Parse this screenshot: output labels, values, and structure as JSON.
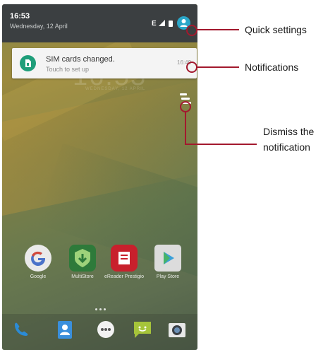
{
  "status_bar": {
    "time": "16:53",
    "date": "Wednesday, 12 April",
    "network_label": "E",
    "icons": [
      "signal-icon",
      "battery-icon",
      "user-icon"
    ]
  },
  "notification": {
    "title": "SIM cards changed.",
    "subtitle": "Touch to set up",
    "time": "16:49",
    "icon": "sim-card-icon",
    "icon_color": "#1f9e7a"
  },
  "home_screen": {
    "apps": [
      {
        "label": "Google",
        "icon": "google-icon"
      },
      {
        "label": "MultiStore",
        "icon": "multistore-icon"
      },
      {
        "label": "eReader Prestigio",
        "icon": "ereader-icon"
      },
      {
        "label": "Play Store",
        "icon": "play-store-icon"
      }
    ],
    "dock": [
      "phone-icon",
      "contacts-icon",
      "app-drawer-icon",
      "messaging-icon",
      "camera-icon"
    ]
  },
  "callouts": {
    "quick_settings": "Quick settings",
    "notifications": "Notifications",
    "dismiss_line1": "Dismiss the",
    "dismiss_line2": "notification",
    "color": "#a3192e"
  }
}
